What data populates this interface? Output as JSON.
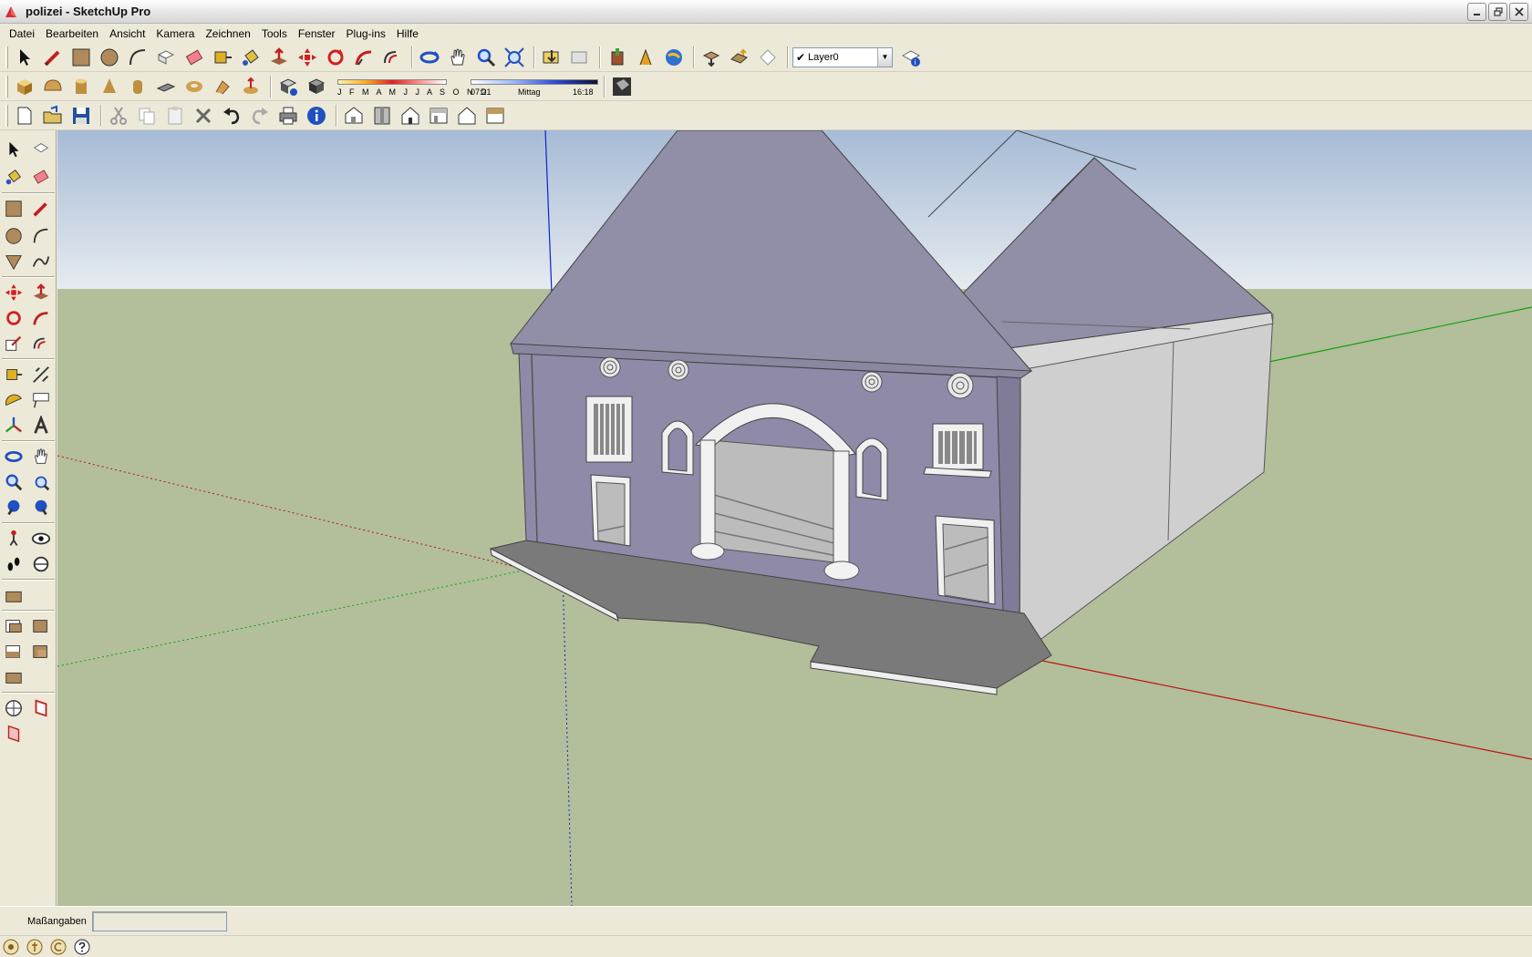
{
  "window": {
    "title": "polizei - SketchUp Pro",
    "buttons": [
      "minimize",
      "restore",
      "close"
    ]
  },
  "menu": {
    "items": [
      "Datei",
      "Bearbeiten",
      "Ansicht",
      "Kamera",
      "Zeichnen",
      "Tools",
      "Fenster",
      "Plug-ins",
      "Hilfe"
    ]
  },
  "layer": {
    "selected": "Layer0",
    "check": "✔"
  },
  "shadow": {
    "months": "J F M A M J J A S O N D",
    "time_start": "07:21",
    "time_mid": "Mittag",
    "time_end": "16:18"
  },
  "status": {
    "measure_label": "Maßangaben",
    "measure_value": ""
  },
  "colors": {
    "sky_top": "#a6bbd6",
    "sky_bottom": "#e6ebef",
    "ground": "#b2bf9a",
    "facade": "#8e8aa8",
    "roof": "#918ea7",
    "side_wall": "#cfcfcf",
    "axis_blue": "#1020d0",
    "axis_red": "#c01010",
    "axis_green": "#10a010"
  }
}
